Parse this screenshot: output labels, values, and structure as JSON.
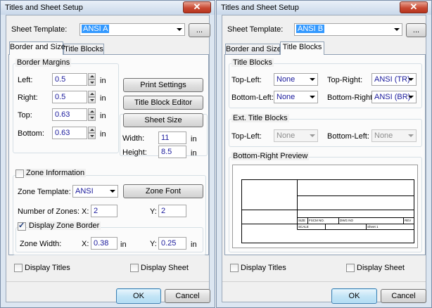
{
  "left": {
    "title": "Titles and Sheet Setup",
    "close": "✕",
    "sheet_template_label": "Sheet Template:",
    "sheet_template_value": "ANSI A",
    "browse": "...",
    "tabs": [
      "Border and Size",
      "Title Blocks"
    ],
    "border_margins": {
      "title": "Border Margins",
      "left_label": "Left:",
      "left_value": "0.5",
      "right_label": "Right:",
      "right_value": "0.5",
      "top_label": "Top:",
      "top_value": "0.63",
      "bottom_label": "Bottom:",
      "bottom_value": "0.63",
      "unit": "in"
    },
    "print_settings": "Print Settings",
    "title_block_editor": "Title Block Editor",
    "sheet_size": {
      "button": "Sheet Size",
      "width_label": "Width:",
      "width_value": "11",
      "height_label": "Height:",
      "height_value": "8.5",
      "unit": "in"
    },
    "zone": {
      "title": "Zone Information",
      "template_label": "Zone Template:",
      "template_value": "ANSI",
      "font_button": "Zone Font",
      "count_label": "Number of Zones:",
      "x_label": "X:",
      "x_value": "2",
      "y_label": "Y:",
      "y_value": "2",
      "display_border": "Display Zone Border",
      "width_label": "Zone Width:",
      "wx_label": "X:",
      "wx_value": "0.38",
      "wy_label": "Y:",
      "wy_value": "0.25",
      "unit": "in"
    },
    "display_titles": "Display Titles",
    "display_sheet": "Display Sheet",
    "ok": "OK",
    "cancel": "Cancel"
  },
  "right": {
    "title": "Titles and Sheet Setup",
    "close": "✕",
    "sheet_template_label": "Sheet Template:",
    "sheet_template_value": "ANSI B",
    "browse": "...",
    "tabs": [
      "Border and Size",
      "Title Blocks"
    ],
    "title_blocks": {
      "title": "Title Blocks",
      "top_left_label": "Top-Left:",
      "top_left_value": "None",
      "top_right_label": "Top-Right:",
      "top_right_value": "ANSI (TR)",
      "bottom_left_label": "Bottom-Left:",
      "bottom_left_value": "None",
      "bottom_right_label": "Bottom-Right:",
      "bottom_right_value": "ANSI (BR)"
    },
    "ext_title_blocks": {
      "title": "Ext. Title Blocks",
      "top_left_label": "Top-Left:",
      "top_left_value": "None",
      "bottom_left_label": "Bottom-Left:",
      "bottom_left_value": "None"
    },
    "preview": {
      "title": "Bottom-Right Preview",
      "size": "SIZE",
      "fscm": "FSCM NO.",
      "dwg": "DWG NO",
      "rev": "REV",
      "scale": "SCALE",
      "sheet": "Sheet 1"
    },
    "display_titles": "Display Titles",
    "display_sheet": "Display Sheet",
    "ok": "OK",
    "cancel": "Cancel"
  }
}
